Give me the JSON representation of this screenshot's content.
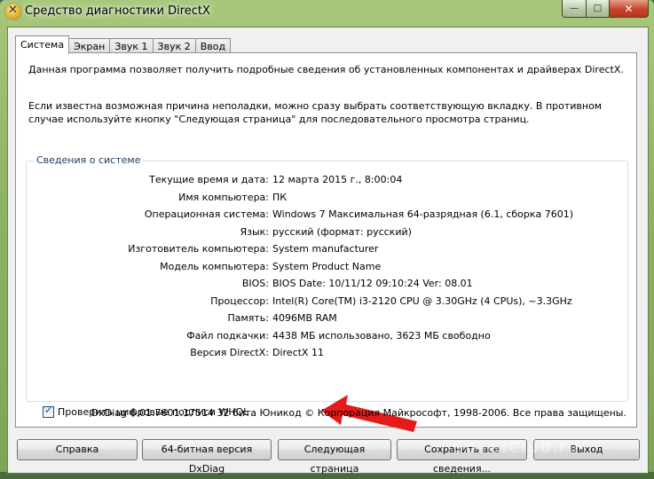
{
  "window": {
    "title": "Средство диагностики DirectX"
  },
  "title_buttons": {
    "minimize": "—",
    "maximize": "□",
    "close": "✕"
  },
  "tabs": [
    {
      "label": "Система",
      "active": true
    },
    {
      "label": "Экран"
    },
    {
      "label": "Звук 1"
    },
    {
      "label": "Звук 2"
    },
    {
      "label": "Ввод"
    }
  ],
  "intro": {
    "line1": "Данная программа позволяет получить подробные сведения об установленных компонентах и драйверах DirectX.",
    "line2": "Если известна возможная причина неполадки, можно сразу выбрать соответствующую вкладку. В противном случае используйте кнопку \"Следующая страница\" для последовательного просмотра страниц."
  },
  "system_info": {
    "group_title": "Сведения о системе",
    "rows": [
      {
        "label": "Текущие время и дата:",
        "value": "12 марта 2015 г., 8:00:04"
      },
      {
        "label": "Имя компьютера:",
        "value": "ПК"
      },
      {
        "label": "Операционная система:",
        "value": "Windows 7 Максимальная 64-разрядная (6.1, сборка 7601)"
      },
      {
        "label": "Язык:",
        "value": "русский (формат: русский)"
      },
      {
        "label": "Изготовитель компьютера:",
        "value": "System manufacturer"
      },
      {
        "label": "Модель компьютера:",
        "value": "System Product Name"
      },
      {
        "label": "BIOS:",
        "value": "BIOS Date: 10/11/12 09:10:24 Ver: 08.01"
      },
      {
        "label": "Процессор:",
        "value": "Intel(R) Core(TM) i3-2120 CPU @ 3.30GHz (4 CPUs), ~3.3GHz"
      },
      {
        "label": "Память:",
        "value": "4096MB RAM"
      },
      {
        "label": "Файл подкачки:",
        "value": "4438 МБ использовано, 3623 МБ свободно"
      },
      {
        "label": "Версия DirectX:",
        "value": "DirectX 11"
      }
    ]
  },
  "whql": {
    "label": "Проверить цифровые подписи WHQL",
    "checked": true
  },
  "footer": "DxDiag 6.01.7601.17514 32 бита Юникод  © Корпорация Майкрософт, 1998-2006.  Все права защищены.",
  "buttons": {
    "help": "Справка",
    "dxdiag64": "64-битная версия DxDiag",
    "next_page": "Следующая страница",
    "save_all": "Сохранить все сведения...",
    "exit": "Выход"
  },
  "watermark": "SovetClub.ru",
  "colors": {
    "arrow": "#e31b1b",
    "titlebar": "#8fb463"
  }
}
